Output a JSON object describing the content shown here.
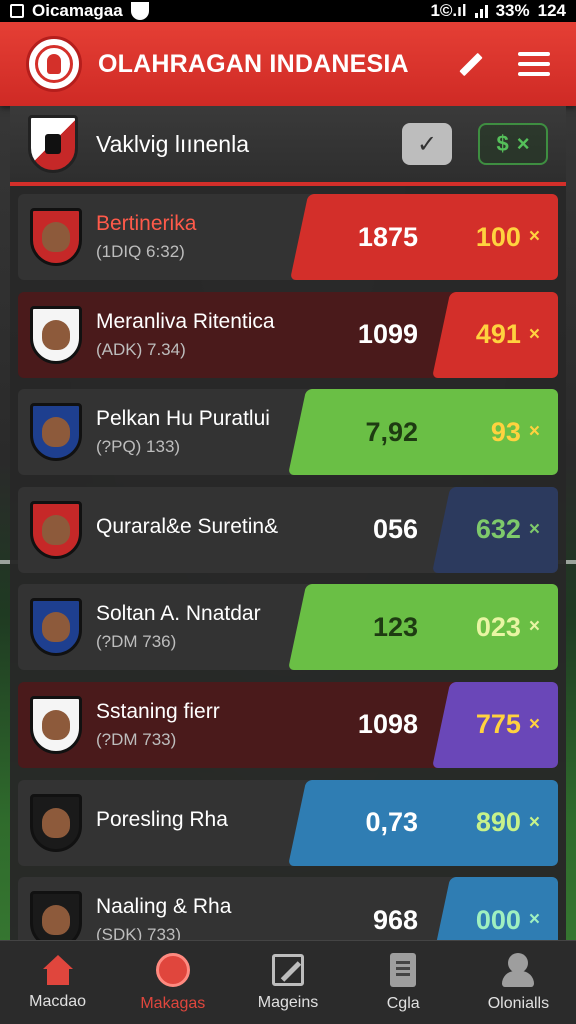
{
  "status_bar": {
    "left_text": "Oicamagaa",
    "right_text": "1©.ıl",
    "battery": "33%",
    "time": "124"
  },
  "header": {
    "title": "OLAHRAGAN INDANESIA"
  },
  "panel": {
    "title": "Vaklvig lıınenla",
    "check_symbol": "✓",
    "dollar_symbol": "$",
    "x_symbol": "×"
  },
  "rows": [
    {
      "name": "Bertinerika",
      "code": "(1DIQ 6:32)",
      "stat": "1875",
      "odds": "100",
      "x": "×",
      "name_color": "#ff5a4a",
      "accent": "#d32f2a",
      "odds_color": "#ffd23f",
      "avatar": "#c62828",
      "row_style": "dark-gray",
      "accent_width": 268
    },
    {
      "name": "Meranliva Ritentica",
      "code": "(ADK) 7.34)",
      "stat": "1099",
      "odds": "491",
      "x": "×",
      "name_color": "#ffffff",
      "accent": "#d32f2a",
      "odds_color": "#ffd23f",
      "avatar": "#f5f5f5",
      "row_style": "dark-red",
      "accent_width": 126
    },
    {
      "name": "Pelkan Hu Puratlui",
      "code": "(?PQ) 133)",
      "stat": "7,92",
      "odds": "93",
      "x": "×",
      "name_color": "#ffffff",
      "accent": "#6abf45",
      "odds_color": "#ffd23f",
      "avatar": "#1e3f8f",
      "row_style": "dark-gray",
      "accent_width": 270,
      "stat_color": "#1e3b12"
    },
    {
      "name": "Quraral&e Suretin&",
      "code": "",
      "stat": "056",
      "odds": "632",
      "x": "×",
      "name_color": "#ffffff",
      "accent": "#2c3a5e",
      "odds_color": "#7ec96b",
      "avatar": "#c62828",
      "row_style": "dark-gray",
      "accent_width": 126
    },
    {
      "name": "Soltan A. Nnatdar",
      "code": "(?DM 736)",
      "stat": "123",
      "odds": "023",
      "x": "×",
      "name_color": "#ffffff",
      "accent": "#6abf45",
      "odds_color": "#e8f5a3",
      "avatar": "#1e3f8f",
      "row_style": "dark-gray",
      "accent_width": 270,
      "stat_color": "#1e3b12"
    },
    {
      "name": "Sstaning fierr",
      "code": "(?DM 733)",
      "stat": "1098",
      "odds": "775",
      "x": "×",
      "name_color": "#ffffff",
      "accent": "#6a47b8",
      "odds_color": "#ffd23f",
      "avatar": "#f5f5f5",
      "row_style": "dark-red",
      "accent_width": 126
    },
    {
      "name": "Poresling Rha",
      "code": "",
      "stat": "0,73",
      "odds": "890",
      "x": "×",
      "name_color": "#ffffff",
      "accent": "#2f7db3",
      "odds_color": "#c7f28a",
      "avatar": "#1a1a1a",
      "row_style": "dark-gray",
      "accent_width": 270
    },
    {
      "name": "Naaling & Rha",
      "code": "(SDK) 733)",
      "stat": "968",
      "odds": "000",
      "x": "×",
      "name_color": "#ffffff",
      "accent": "#2f7db3",
      "odds_color": "#9ff0c0",
      "avatar": "#1a1a1a",
      "row_style": "dark-gray",
      "accent_width": 126
    }
  ],
  "nav": [
    {
      "label": "Macdao",
      "icon": "home-icon",
      "active": false
    },
    {
      "label": "Makagas",
      "icon": "ball-icon",
      "active": true
    },
    {
      "label": "Mageins",
      "icon": "edit-icon",
      "active": false
    },
    {
      "label": "Cgla",
      "icon": "doc-icon",
      "active": false
    },
    {
      "label": "Olonialls",
      "icon": "people-icon",
      "active": false
    }
  ]
}
